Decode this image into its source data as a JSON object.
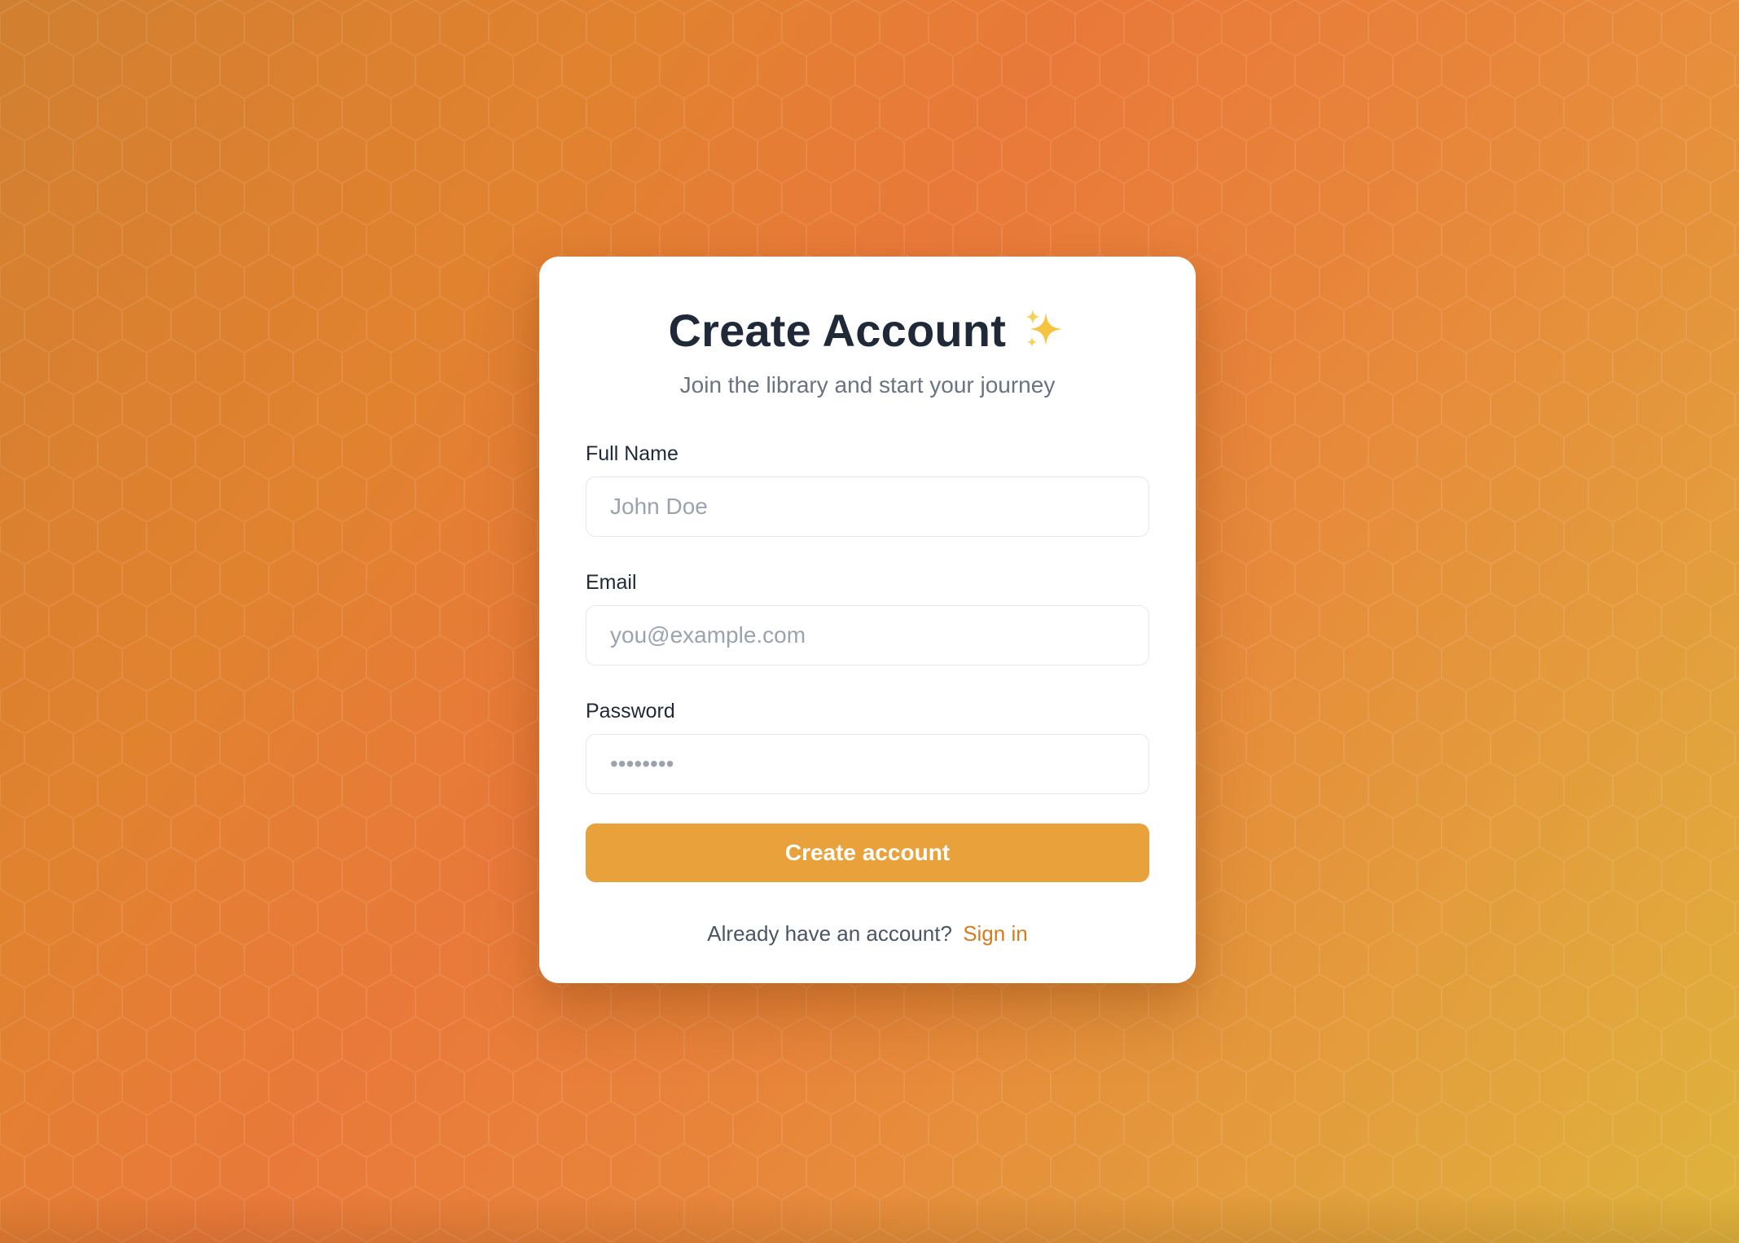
{
  "page": {
    "background_colors": [
      "#d17f30",
      "#e9793a",
      "#dfb33c"
    ]
  },
  "card": {
    "title": "Create Account",
    "title_icon": "sparkles-icon",
    "subtitle": "Join the library and start your journey"
  },
  "form": {
    "full_name": {
      "label": "Full Name",
      "placeholder": "John Doe",
      "value": ""
    },
    "email": {
      "label": "Email",
      "placeholder": "you@example.com",
      "value": ""
    },
    "password": {
      "label": "Password",
      "placeholder": "••••••••",
      "value": ""
    },
    "submit_label": "Create account"
  },
  "footer": {
    "prompt": "Already have an account?",
    "link_label": "Sign in"
  },
  "colors": {
    "accent": "#e9a23b",
    "link": "#d97a1f",
    "title": "#1f2937",
    "muted": "#6b7280"
  }
}
